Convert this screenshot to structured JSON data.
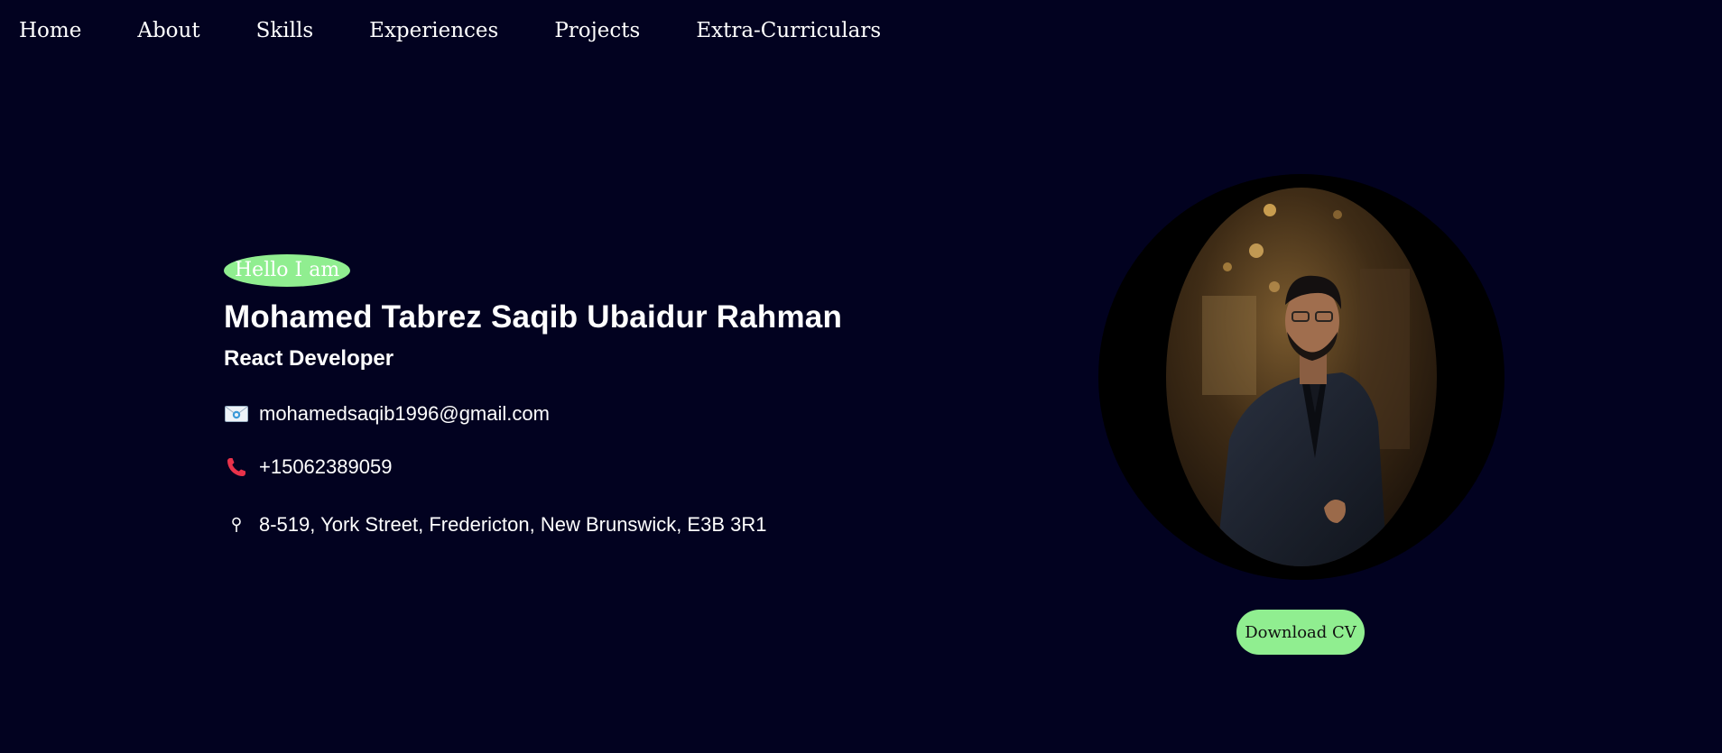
{
  "nav": {
    "items": [
      {
        "label": "Home"
      },
      {
        "label": "About"
      },
      {
        "label": "Skills"
      },
      {
        "label": "Experiences"
      },
      {
        "label": "Projects"
      },
      {
        "label": "Extra-Curriculars"
      }
    ]
  },
  "hero": {
    "greeting": "Hello I am",
    "name": "Mohamed Tabrez Saqib Ubaidur Rahman",
    "role": "React Developer",
    "contacts": {
      "email": {
        "icon": "envelope-icon",
        "text": "mohamedsaqib1996@gmail.com"
      },
      "phone": {
        "icon": "phone-icon",
        "text": "+15062389059"
      },
      "address": {
        "icon": "location-pin-icon",
        "text": "8-519, York Street, Fredericton, New Brunswick, E3B 3R1"
      }
    },
    "download_label": "Download CV"
  },
  "colors": {
    "background": "#020220",
    "accent": "#90ee90",
    "photo_frame": "#000000",
    "phone_icon": "#e8324a"
  }
}
